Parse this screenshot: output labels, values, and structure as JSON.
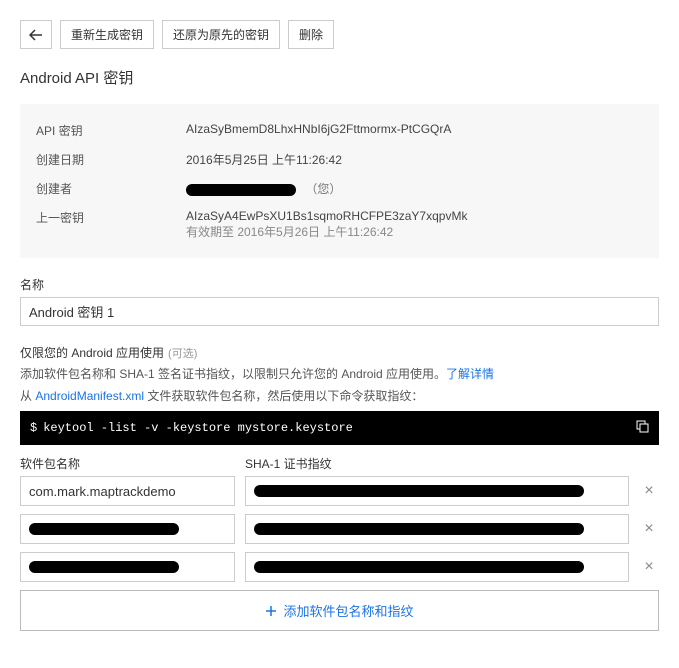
{
  "toolbar": {
    "regenerate": "重新生成密钥",
    "revert": "还原为原先的密钥",
    "delete": "删除"
  },
  "title": "Android API 密钥",
  "info": {
    "apiKeyLabel": "API 密钥",
    "apiKeyValue": "AIzaSyBmemD8LhxHNbI6jG2Fttmormx-PtCGQrA",
    "createdLabel": "创建日期",
    "createdValue": "2016年5月25日 上午11:26:42",
    "creatorLabel": "创建者",
    "creatorYou": "（您）",
    "prevKeyLabel": "上一密钥",
    "prevKeyValue": "AIzaSyA4EwPsXU1Bs1sqmoRHCFPE3zaY7xqpvMk",
    "prevKeyExpiry": "有效期至 2016年5月26日 上午11:26:42"
  },
  "nameField": {
    "label": "名称",
    "value": "Android 密钥 1"
  },
  "restrict": {
    "title": "仅限您的 Android 应用使用",
    "optional": "(可选)",
    "desc1a": "添加软件包名称和 SHA-1 签名证书指纹，以限制只允许您的 Android 应用使用。",
    "learnMore": "了解详情",
    "desc2a": "从 ",
    "desc2b": "AndroidManifest.xml",
    "desc2c": " 文件获取软件包名称，然后使用以下命令获取指纹：",
    "command": "keytool -list -v -keystore mystore.keystore",
    "pkgHeader": "软件包名称",
    "shaHeader": "SHA-1 证书指纹",
    "rows": [
      {
        "pkg": "com.mark.maptrackdemo"
      },
      {
        "pkg": ""
      },
      {
        "pkg": ""
      }
    ],
    "addLabel": "添加软件包名称和指纹"
  }
}
